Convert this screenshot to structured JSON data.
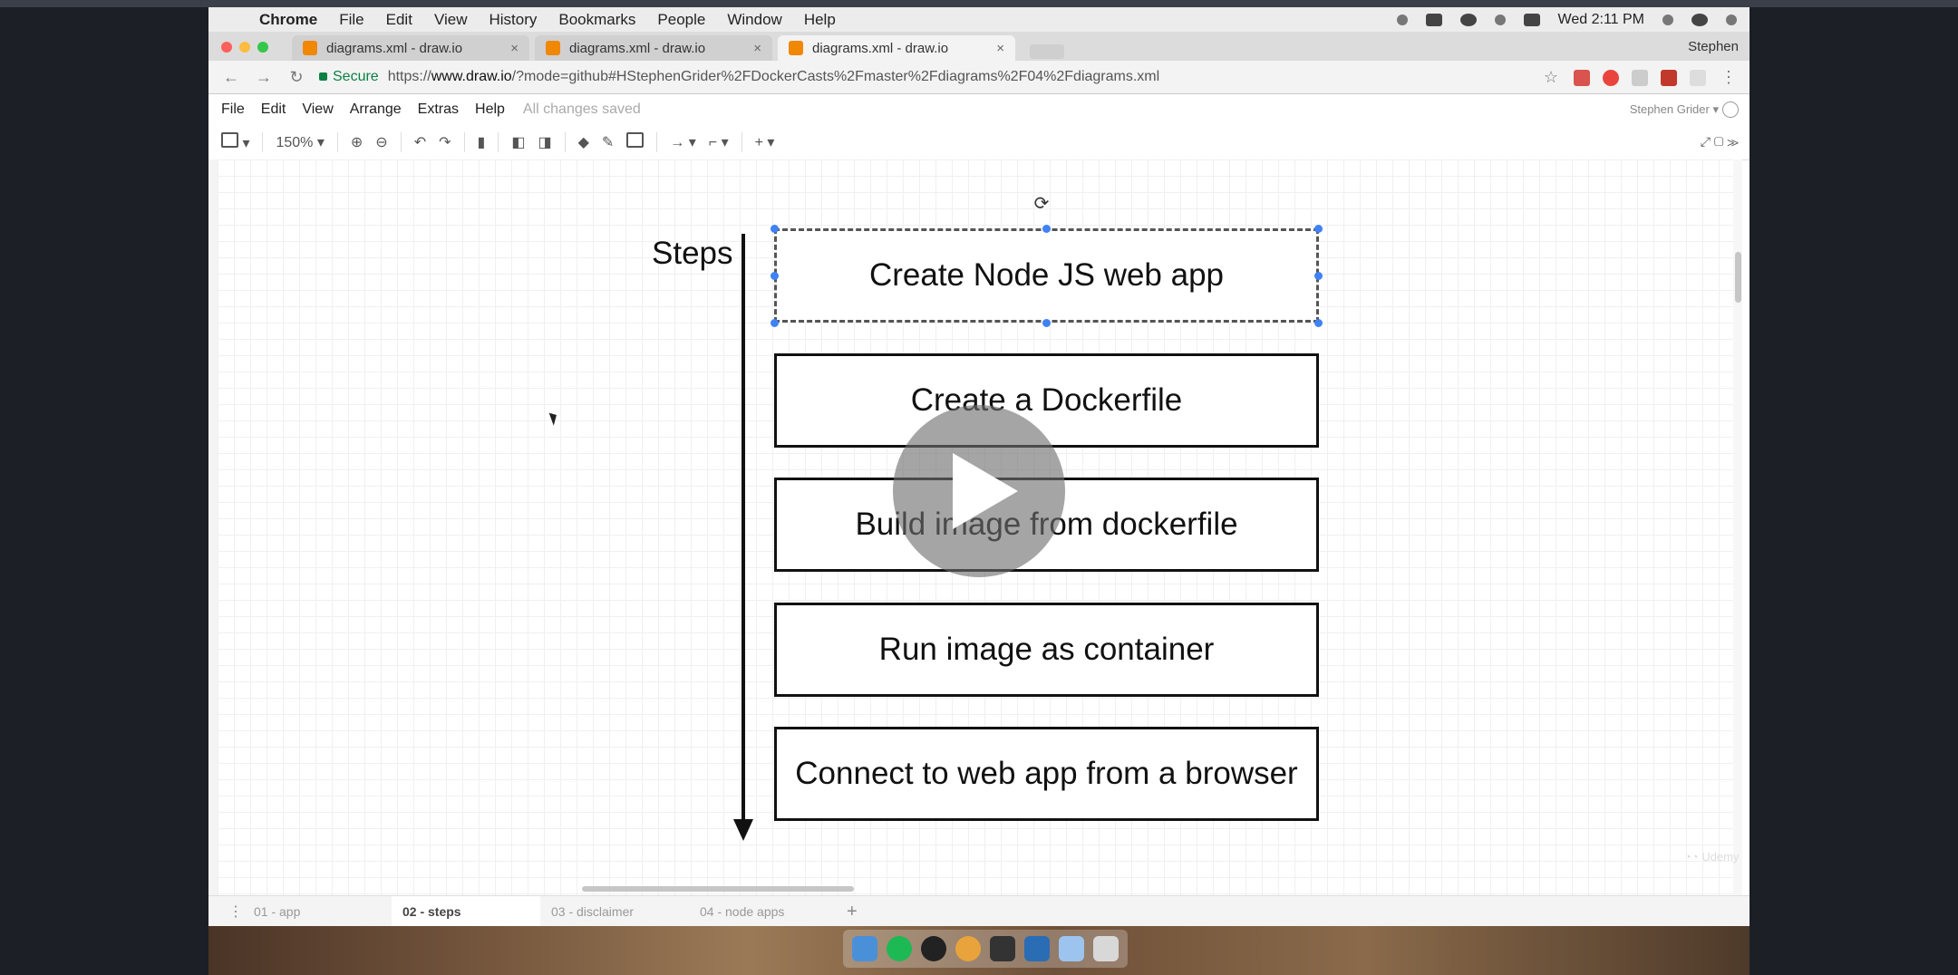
{
  "mac_menubar": {
    "app": "Chrome",
    "items": [
      "File",
      "Edit",
      "View",
      "History",
      "Bookmarks",
      "People",
      "Window",
      "Help"
    ],
    "clock": "Wed 2:11 PM"
  },
  "browser": {
    "tabs": [
      {
        "title": "diagrams.xml - draw.io",
        "close": "×"
      },
      {
        "title": "diagrams.xml - draw.io",
        "close": "×"
      },
      {
        "title": "diagrams.xml - draw.io",
        "close": "×"
      }
    ],
    "profile_name": "Stephen",
    "secure_label": "Secure",
    "url_scheme": "https://",
    "url_host": "www.draw.io",
    "url_rest": "/?mode=github#HStephenGrider%2FDockerCasts%2Fmaster%2Fdiagrams%2F04%2Fdiagrams.xml"
  },
  "drawio": {
    "menu": [
      "File",
      "Edit",
      "View",
      "Arrange",
      "Extras",
      "Help"
    ],
    "save_status": "All changes saved",
    "user": "Stephen Grider ▾",
    "zoom": "150%"
  },
  "diagram": {
    "steps_label": "Steps",
    "boxes": [
      "Create Node JS web app",
      "Create a Dockerfile",
      "Build image from dockerfile",
      "Run image as container",
      "Connect to web app from a browser"
    ]
  },
  "page_tabs": [
    "01 - app",
    "02 - steps",
    "03 - disclaimer",
    "04 - node apps"
  ],
  "colors": {
    "selection_handle": "#3f82f4",
    "drawio_favicon": "#f08705",
    "secure_green": "#0b8043"
  },
  "icons": {
    "play": "play-icon",
    "rotate": "rotate-icon"
  }
}
